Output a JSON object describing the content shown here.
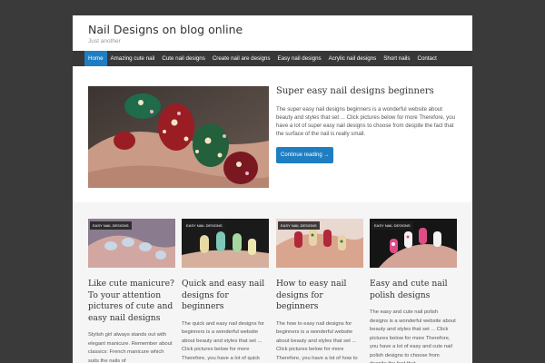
{
  "site": {
    "title": "Nail Designs on blog online",
    "description": "Just another"
  },
  "nav": [
    {
      "label": "Home"
    },
    {
      "label": "Amazing cute nail"
    },
    {
      "label": "Cute nail designs"
    },
    {
      "label": "Create nail are designs"
    },
    {
      "label": "Easy nail designs"
    },
    {
      "label": "Acrylic nail designs"
    },
    {
      "label": "Short nails"
    },
    {
      "label": "Contact"
    }
  ],
  "featured": {
    "title": "Super easy nail designs beginners",
    "excerpt": "The super easy nail designs beginners is a wonderful website about beauty and styles that set ... Click pictures below for more Therefore, you have a lot of super easy nail designs to choose from despite the fact that the surface of the nail is really small.",
    "button": "Continue reading →"
  },
  "posts": [
    {
      "category": "EASY NAIL DESIGNS",
      "title": "Like cute manicure? To your attention pictures of cute and easy nail designs",
      "excerpt": "Stylish girl always stands out with elegant manicure. Remember about classics: French manicure which suits the nails of"
    },
    {
      "category": "EASY NAIL DESIGNS",
      "title": "Quick and easy nail designs for beginners",
      "excerpt": "The quick and easy nail designs for beginners is a wonderful website about beauty and styles that set ... Click pictures below for more Therefore, you have a lot of quick and easy nail designs"
    },
    {
      "category": "EASY NAIL DESIGNS",
      "title": "How to easy nail designs for beginners",
      "excerpt": "The how to easy nail designs for beginners is a wonderful website about beauty and styles that set ... Click pictures below for more Therefore, you have a lot of how to easy nail designs for beginners"
    },
    {
      "category": "EASY NAIL DESIGNS",
      "title": "Easy and cute nail polish designs",
      "excerpt": "The easy and cute nail polish designs is a wonderful website about beauty and styles that set ... Click pictures below for more Therefore, you have a lot of easy and cute nail polish designs to choose from despite the fact that"
    }
  ],
  "colors": {
    "background": "#3a3a3a",
    "nav": "#383838",
    "accent": "#1f7ec2"
  }
}
